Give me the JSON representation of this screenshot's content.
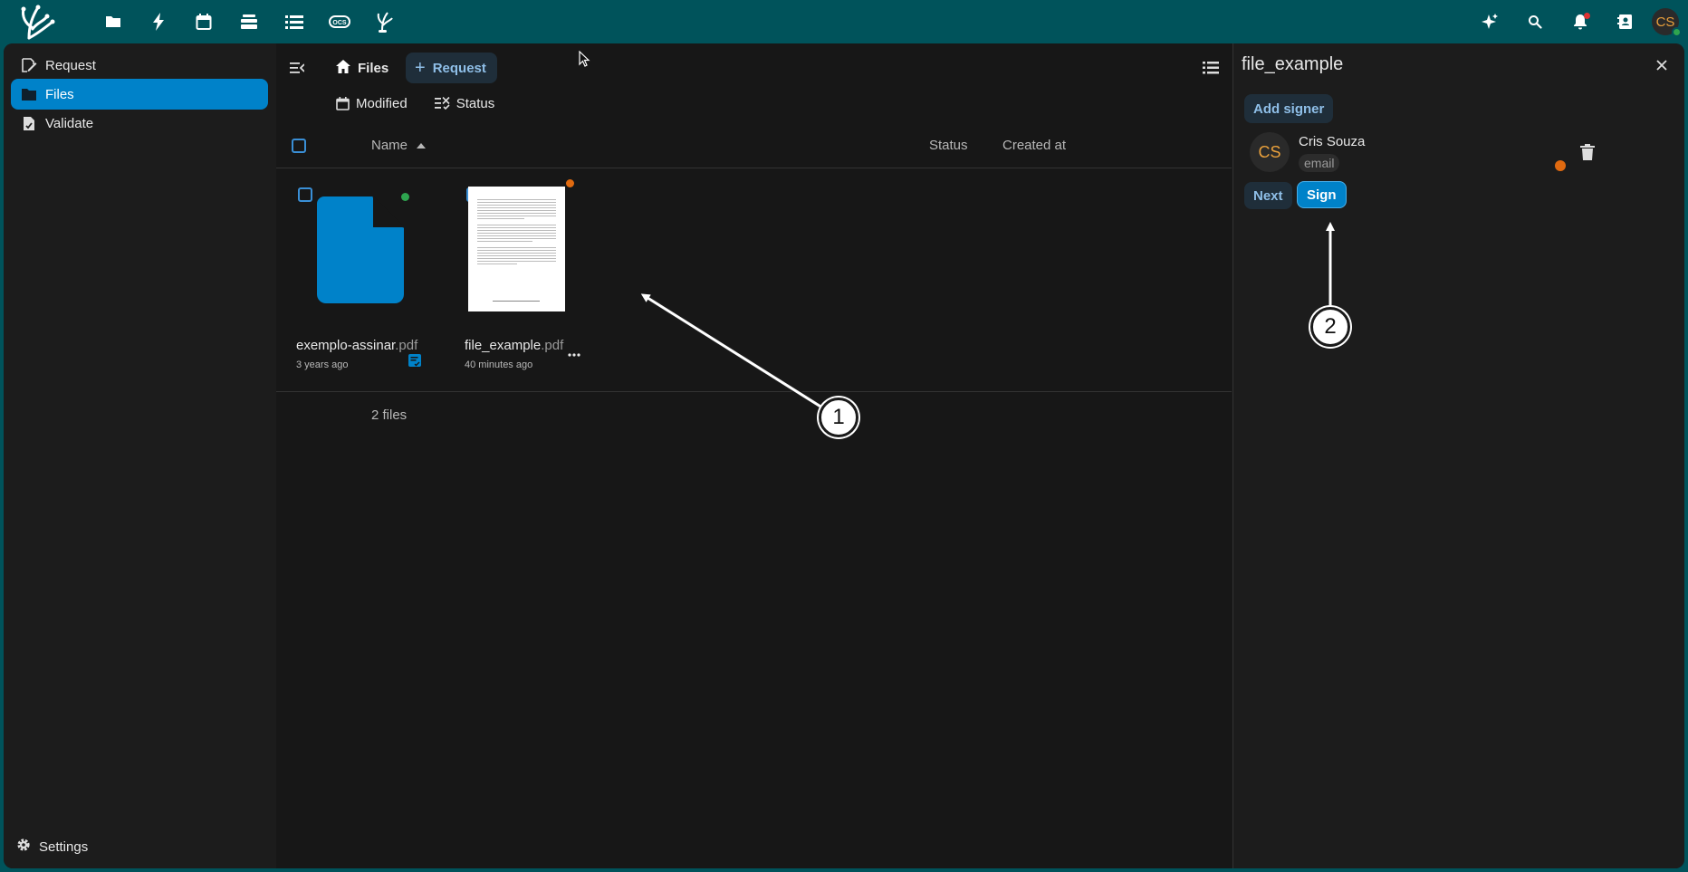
{
  "topbar": {
    "apps": [
      "files-icon",
      "activity-icon",
      "calendar-icon",
      "deck-icon",
      "tasks-icon",
      "ocs-icon",
      "libresign-icon"
    ],
    "avatar_initials": "CS"
  },
  "leftnav": {
    "items": [
      {
        "label": "Request",
        "icon": "request-icon",
        "active": false
      },
      {
        "label": "Files",
        "icon": "folder-icon",
        "active": true
      },
      {
        "label": "Validate",
        "icon": "validate-icon",
        "active": false
      }
    ],
    "settings_label": "Settings"
  },
  "breadcrumb": {
    "files_label": "Files",
    "request_label": "Request"
  },
  "filters": {
    "modified_label": "Modified",
    "status_label": "Status"
  },
  "table": {
    "headers": {
      "name": "Name",
      "status": "Status",
      "created_at": "Created at"
    }
  },
  "files": [
    {
      "basename": "exemplo-assinar",
      "ext": ".pdf",
      "date": "3 years ago",
      "status_color": "#2ea44f"
    },
    {
      "basename": "file_example",
      "ext": ".pdf",
      "date": "40 minutes ago",
      "status_color": "#e06a10"
    }
  ],
  "summary": "2 files",
  "sidebar": {
    "title": "file_example",
    "add_signer_label": "Add signer",
    "signer": {
      "initials": "CS",
      "name": "Cris Souza",
      "method": "email"
    },
    "next_label": "Next",
    "sign_label": "Sign"
  },
  "annotations": {
    "badge_1": "1",
    "badge_2": "2"
  },
  "colors": {
    "header_bg": "#00535b",
    "primary": "#0082c9",
    "panel_bg": "#171717",
    "pending_dot": "#e06a10",
    "signed_dot": "#2ea44f"
  }
}
